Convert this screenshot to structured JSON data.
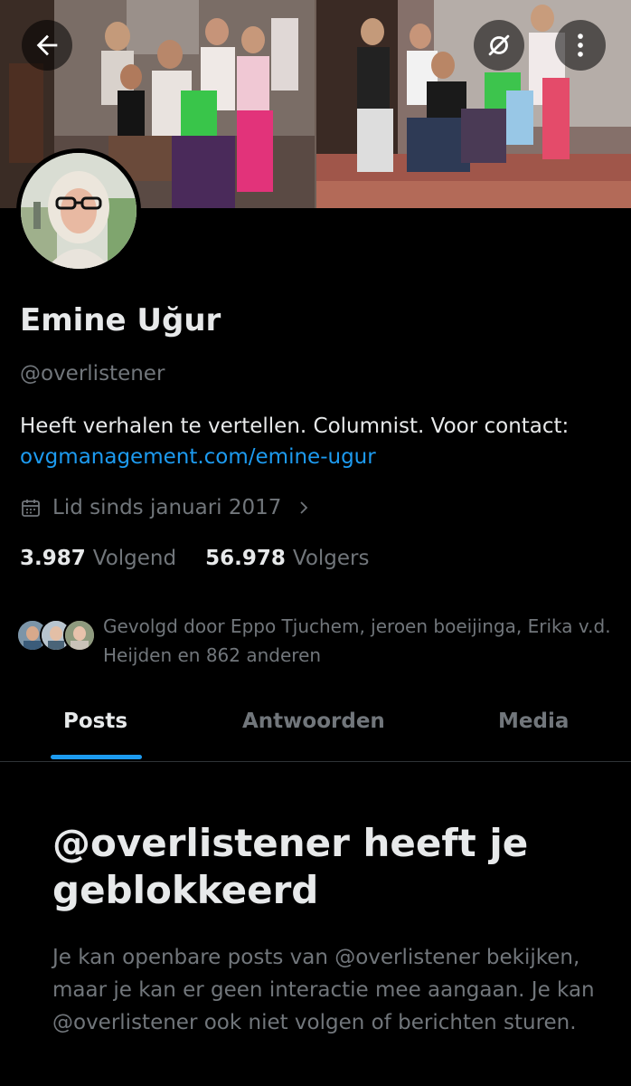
{
  "header": {
    "back_icon": "arrow-left-icon",
    "hide_icon": "eye-slash-icon",
    "more_icon": "more-vertical-icon"
  },
  "profile": {
    "display_name": "Emine Uğur",
    "handle": "@overlistener",
    "bio_text": "Heeft verhalen te vertellen. Columnist. Voor contact:",
    "bio_link": "ovgmanagement.com/emine-ugur",
    "joined": "Lid sinds januari 2017",
    "following_count": "3.987",
    "following_label": "Volgend",
    "followers_count": "56.978",
    "followers_label": "Volgers",
    "followed_by": "Gevolgd door Eppo Tjuchem, jeroen boeijinga, Erika v.d. Heijden en 862 anderen"
  },
  "tabs": [
    {
      "label": "Posts",
      "active": true
    },
    {
      "label": "Antwoorden",
      "active": false
    },
    {
      "label": "Media",
      "active": false
    }
  ],
  "blocked": {
    "title": "@overlistener heeft je geblokkeerd",
    "description": "Je kan openbare posts van @overlistener bekijken, maar je kan er geen interactie mee aangaan. Je kan @overlistener ook niet volgen of berichten sturen."
  },
  "colors": {
    "background": "#000000",
    "primary_text": "#e7e9ea",
    "secondary_text": "#71767b",
    "accent": "#1d9bf0",
    "divider": "#2f3336"
  }
}
